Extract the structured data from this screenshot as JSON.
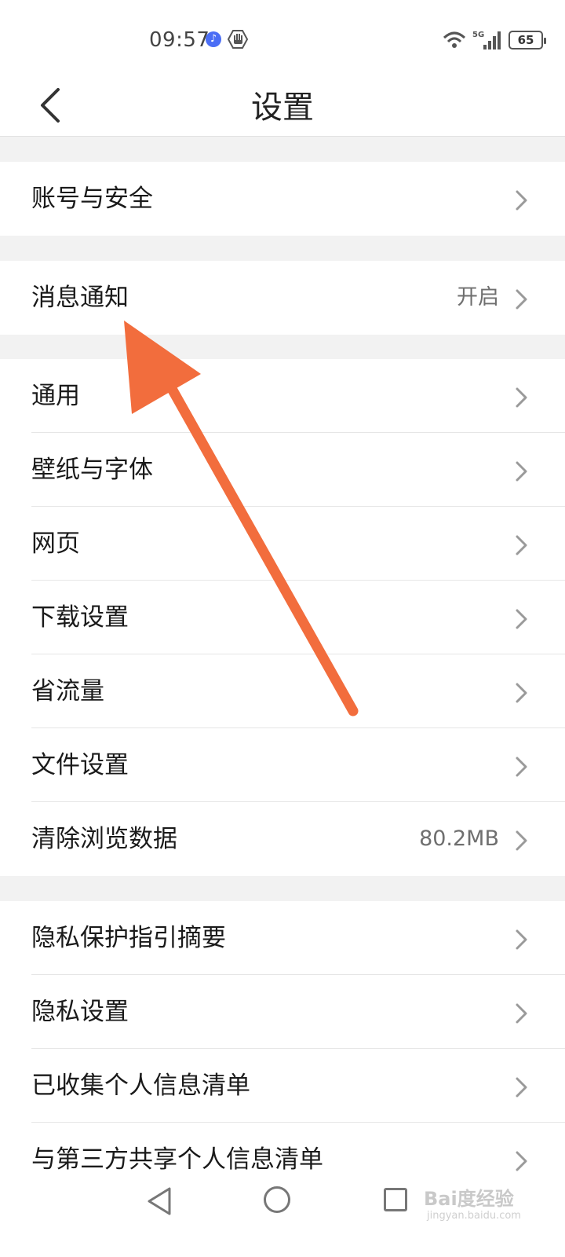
{
  "status_bar": {
    "time": "09:57",
    "network": "5G",
    "battery": "65"
  },
  "header": {
    "title": "设置"
  },
  "groups": [
    [
      {
        "label": "账号与安全",
        "value": ""
      }
    ],
    [
      {
        "label": "消息通知",
        "value": "开启"
      }
    ],
    [
      {
        "label": "通用",
        "value": ""
      },
      {
        "label": "壁纸与字体",
        "value": ""
      },
      {
        "label": "网页",
        "value": ""
      },
      {
        "label": "下载设置",
        "value": ""
      },
      {
        "label": "省流量",
        "value": ""
      },
      {
        "label": "文件设置",
        "value": ""
      },
      {
        "label": "清除浏览数据",
        "value": "80.2MB"
      }
    ],
    [
      {
        "label": "隐私保护指引摘要",
        "value": ""
      },
      {
        "label": "隐私设置",
        "value": ""
      },
      {
        "label": "已收集个人信息清单",
        "value": ""
      },
      {
        "label": "与第三方共享个人信息清单",
        "value": ""
      }
    ]
  ],
  "watermark": {
    "text": "Bai度经验",
    "sub": "jingyan.baidu.com"
  },
  "colors": {
    "annotation_arrow": "#f26d3d",
    "background": "#f2f2f2"
  }
}
